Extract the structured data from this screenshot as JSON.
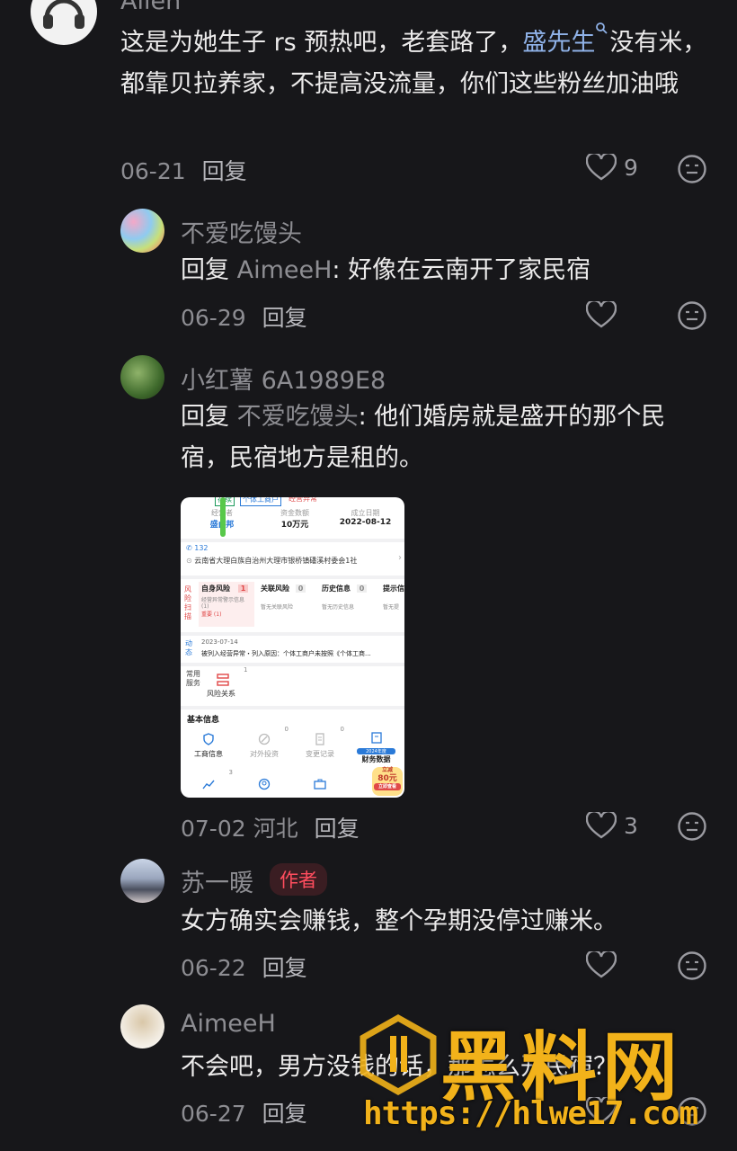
{
  "comments": [
    {
      "username": "Allen",
      "text_parts": [
        "这是为她生子 rs 预热吧，老套路了，",
        "盛先生",
        "没有米，都靠贝拉养家，不提高没流量，你们这些粉丝加油哦"
      ],
      "date": "06-21",
      "reply_label": "回复",
      "likes": "9"
    },
    {
      "username": "不爱吃馒头",
      "reply_prefix": "回复",
      "reply_to": "AimeeH",
      "text": ": 好像在云南开了家民宿",
      "date": "06-29",
      "reply_label": "回复"
    },
    {
      "username": "小红薯 6A1989E8",
      "reply_prefix": "回复",
      "reply_to": "不爱吃馒头",
      "text": ": 他们婚房就是盛开的那个民宿，民宿地方是租的。",
      "date": "07-02",
      "location": "河北",
      "reply_label": "回复",
      "likes": "3"
    },
    {
      "username": "苏一暖",
      "badge": "作者",
      "text": "女方确实会赚钱，整个孕期没停过赚米。",
      "date": "06-22",
      "reply_label": "回复"
    },
    {
      "username": "AimeeH",
      "text": "不会吧，男方没钱的话，那怎么开民宿？",
      "date": "06-27",
      "reply_label": "回复"
    }
  ],
  "card": {
    "tags": [
      "存续",
      "个体工商户",
      "经营异常"
    ],
    "stats": [
      {
        "label": "经营者",
        "value": "盛■邦"
      },
      {
        "label": "资金数额",
        "value": "10万元"
      },
      {
        "label": "成立日期",
        "value": "2022-08-12"
      }
    ],
    "phone": "132",
    "address": "云南省大理白族自治州大理市银桥镇磻溪村委会1社",
    "risk_side": "风险扫描",
    "risk_cols": [
      {
        "title": "自身风险",
        "count": "1",
        "sub1": "经营异常警示信息",
        "sub2": "(1)",
        "sub3": "重要 (1)"
      },
      {
        "title": "关联风险",
        "count": "0",
        "sub1": "暂无关联风险"
      },
      {
        "title": "历史信息",
        "count": "0",
        "sub1": "暂无历史信息"
      },
      {
        "title": "提示信",
        "sub1": "暂无提"
      }
    ],
    "dyn_side": "动态",
    "dyn_date": "2023-07-14",
    "dyn_text": "被列入经营异常・列入原因：个体工商户未按照《个体工商...",
    "svc_side": "常用服务",
    "svc_item": "风险关系",
    "svc_count": "1",
    "basic_title": "基本信息",
    "basic_items": [
      {
        "label": "工商信息",
        "count": ""
      },
      {
        "label": "对外投资",
        "count": "0"
      },
      {
        "label": "变更记录",
        "count": "0"
      },
      {
        "label": "财务数据",
        "count": "",
        "badge": "2024年度"
      }
    ],
    "row2_counts": [
      "3",
      "",
      ""
    ],
    "promo": [
      "立减",
      "80元",
      "立即查看"
    ]
  },
  "watermark": {
    "title": "黑料网",
    "url": "https://hlwe17.com"
  }
}
